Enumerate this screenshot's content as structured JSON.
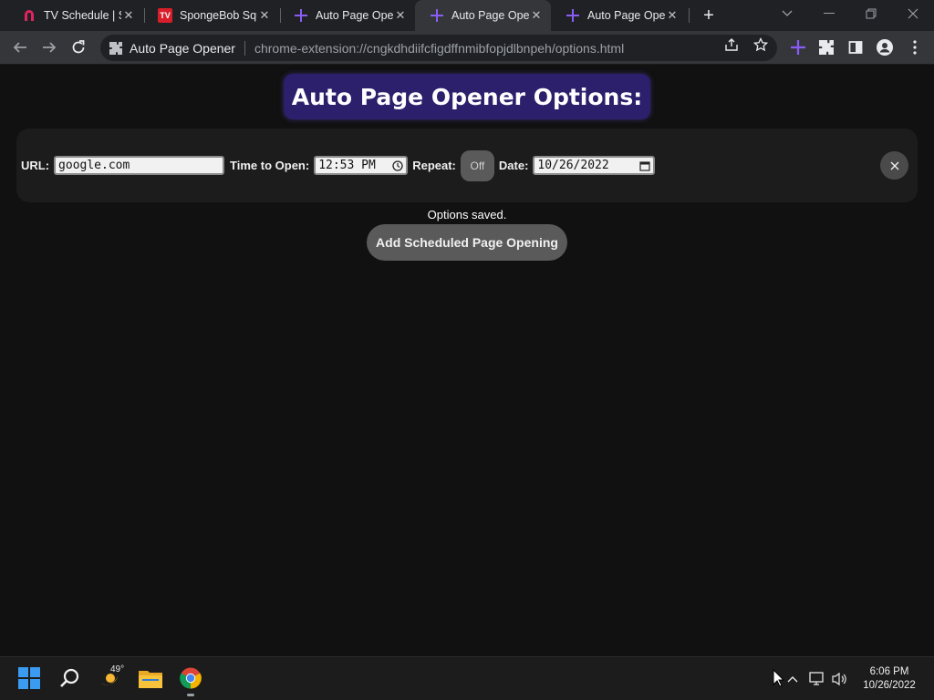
{
  "browser": {
    "tabs": [
      {
        "title": "TV Schedule | Sl",
        "favicon": "magnet-icon"
      },
      {
        "title": "SpongeBob Squ",
        "favicon": "tv-guide-icon"
      },
      {
        "title": "Auto Page Open",
        "favicon": "plus-extension-icon"
      },
      {
        "title": "Auto Page Open",
        "favicon": "plus-extension-icon"
      },
      {
        "title": "Auto Page Open",
        "favicon": "plus-extension-icon"
      }
    ],
    "active_tab_index": 3,
    "omnibox": {
      "extension_name": "Auto Page Opener",
      "url": "chrome-extension://cngkdhdiifcfigdffnmibfopjdlbnpeh/options.html"
    },
    "favicon_labels": {
      "tv_guide": "TV"
    }
  },
  "page": {
    "title": "Auto Page Opener Options:",
    "entry": {
      "url_label": "URL:",
      "url_value": "google.com",
      "time_label": "Time to Open:",
      "time_value": "12:53 PM",
      "repeat_label": "Repeat:",
      "repeat_value": "Off",
      "date_label": "Date:",
      "date_value": "10/26/2022"
    },
    "status": "Options saved.",
    "add_button": "Add Scheduled Page Opening"
  },
  "taskbar": {
    "weather_temp": "49°",
    "clock_time": "6:06 PM",
    "clock_date": "10/26/2022"
  },
  "colors": {
    "title_bg": "#2c1f6b",
    "extension_purple": "#8a5cf6",
    "page_bg": "#111111"
  }
}
